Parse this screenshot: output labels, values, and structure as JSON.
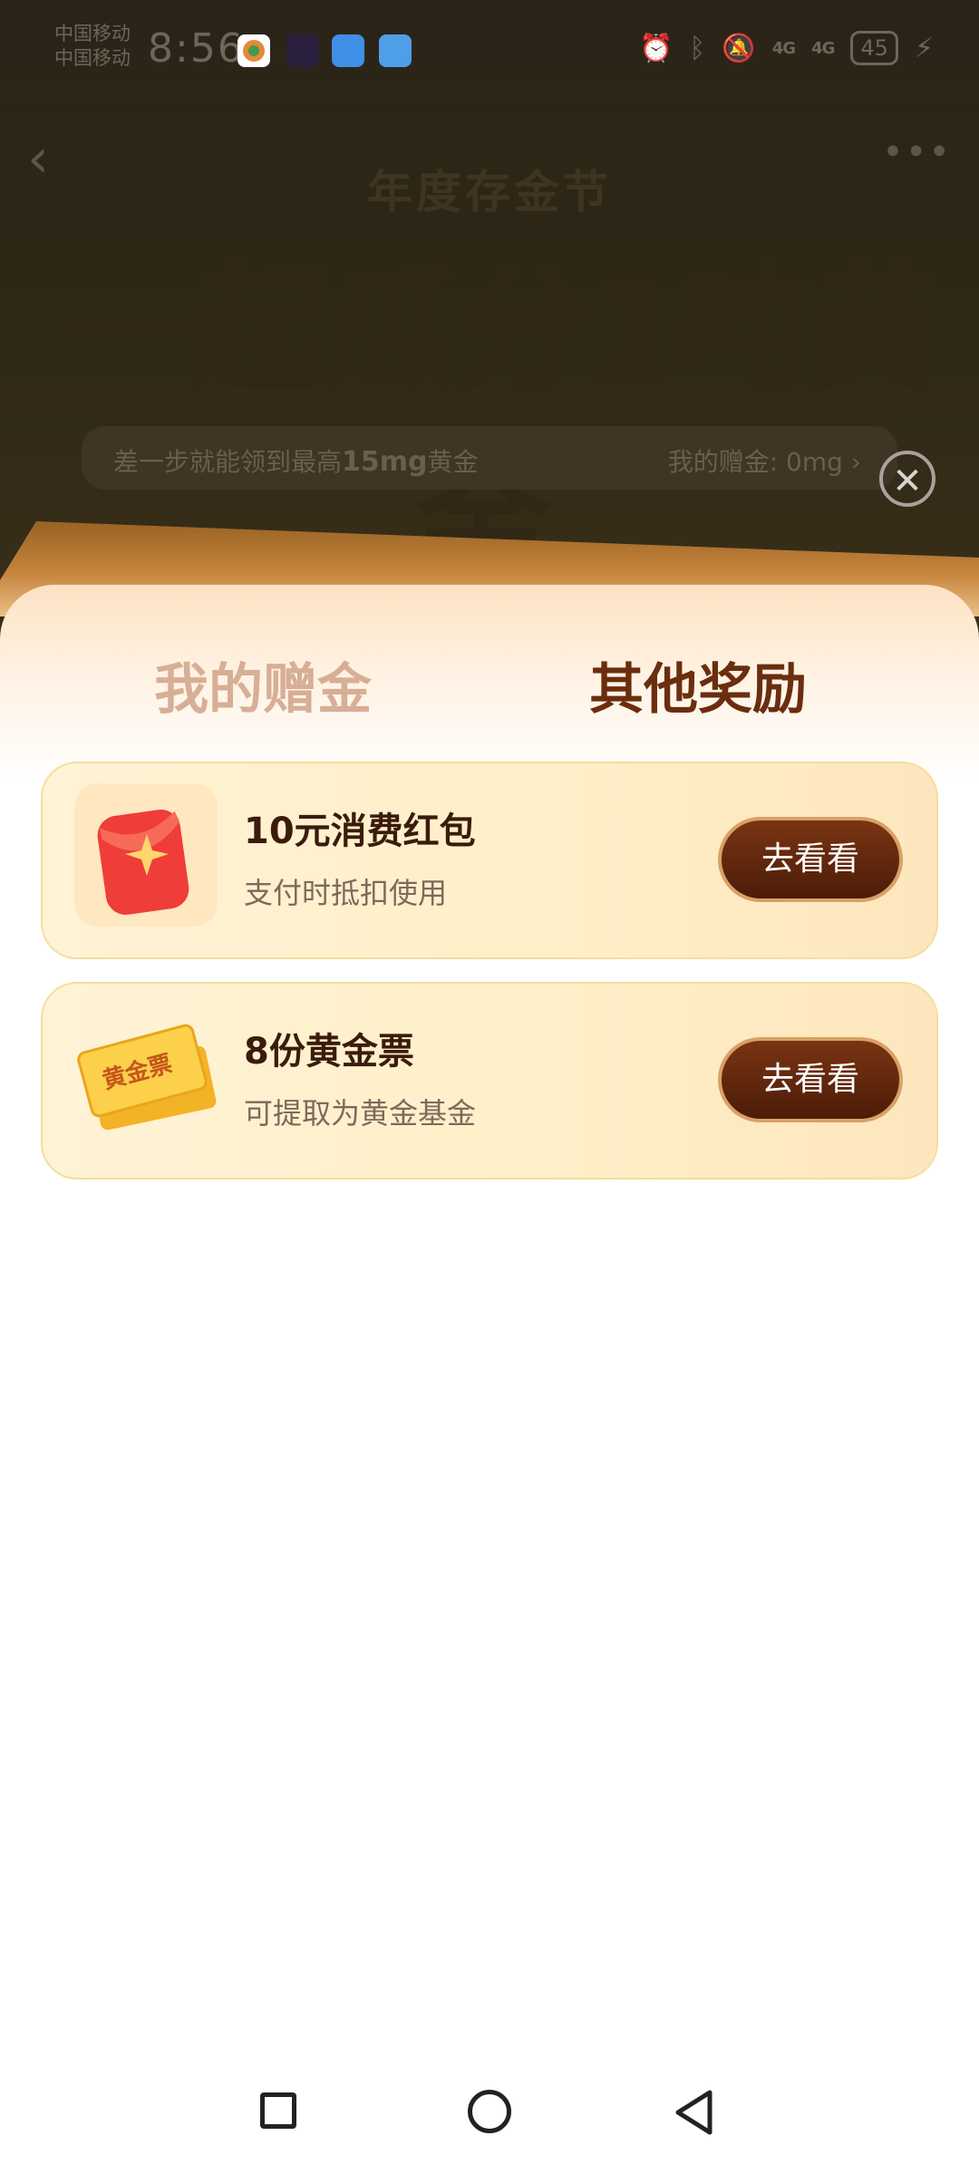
{
  "status_bar": {
    "carrier_1": "中国移动",
    "carrier_2": "中国移动",
    "time": "8:56",
    "network_1": "4G",
    "network_2": "4G",
    "battery": "45"
  },
  "background_page": {
    "subtitle": "年度存金节",
    "title": "一起瓜分1吨黄金",
    "progress_prefix": "差一步就能领到最高",
    "progress_amount": "15mg",
    "progress_suffix": "黄金",
    "my_gift_label": "我的赠金: 0mg",
    "my_gift_chevron": "›"
  },
  "sheet": {
    "tabs": [
      {
        "label": "我的赠金",
        "active": false
      },
      {
        "label": "其他奖励",
        "active": true
      }
    ],
    "rewards": [
      {
        "title": "10元消费红包",
        "desc": "支付时抵扣使用",
        "button": "去看看",
        "icon": "red-envelope-icon"
      },
      {
        "title": "8份黄金票",
        "desc": "可提取为黄金基金",
        "button": "去看看",
        "icon": "gold-ticket-icon",
        "icon_text": "黄金票"
      }
    ]
  },
  "colors": {
    "active_tab": "#6a2e0e",
    "inactive_tab": "#d7ae96",
    "button_bg": "#5a230b",
    "card_border": "#f5dd9c"
  }
}
